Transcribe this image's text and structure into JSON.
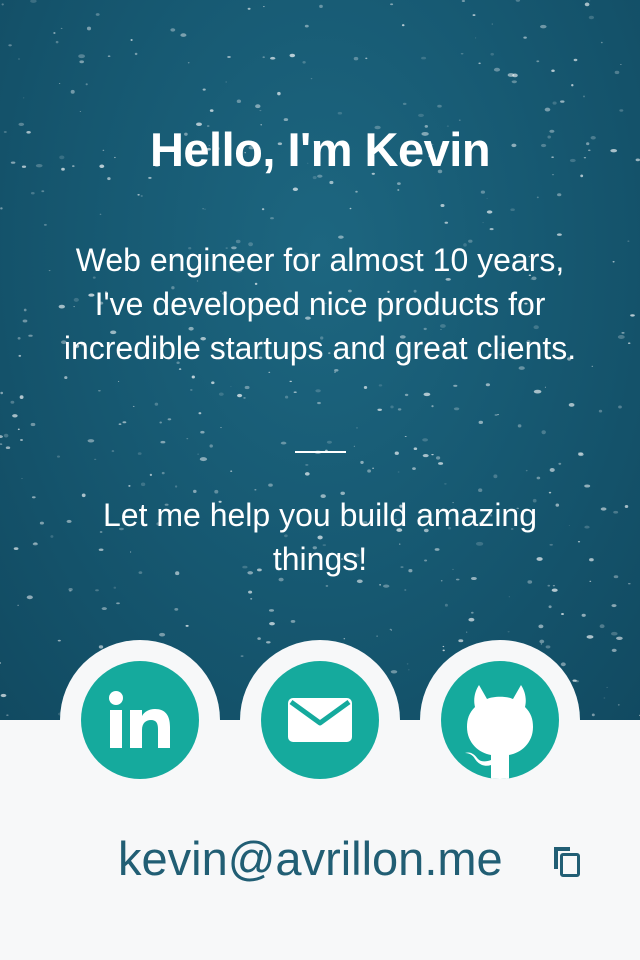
{
  "hero": {
    "title": "Hello, I'm Kevin",
    "bio": "Web engineer for almost 10 years, I've developed nice products for incredible startups and great clients.",
    "cta": "Let me help you build amazing things!"
  },
  "social": [
    {
      "name": "LinkedIn",
      "icon": "linkedin-icon"
    },
    {
      "name": "Email",
      "icon": "mail-icon"
    },
    {
      "name": "GitHub",
      "icon": "github-icon"
    }
  ],
  "contact": {
    "email": "kevin@avrillon.me",
    "copy_icon": "copy-icon"
  },
  "colors": {
    "hero_bg": "#175a73",
    "accent": "#15aa9d",
    "email_text": "#215e74",
    "page_bg": "#f7f8f9"
  }
}
